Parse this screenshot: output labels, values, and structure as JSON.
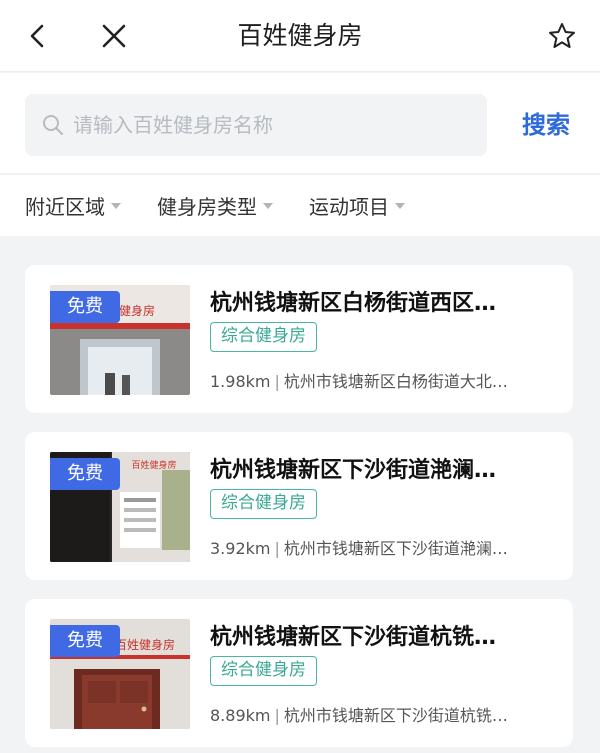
{
  "header": {
    "title": "百姓健身房",
    "back_icon": "chevron-left-icon",
    "close_icon": "close-icon",
    "favorite_icon": "star-outline-icon"
  },
  "search": {
    "placeholder": "请输入百姓健身房名称",
    "value": "",
    "button_label": "搜索",
    "icon": "search-icon"
  },
  "filters": [
    {
      "label": "附近区域"
    },
    {
      "label": "健身房类型"
    },
    {
      "label": "运动项目"
    }
  ],
  "cards": [
    {
      "badge": "免费",
      "title": "杭州钱塘新区白杨街道西区…",
      "tag": "综合健身房",
      "distance": "1.98km",
      "separator": "|",
      "address": "杭州市钱塘新区白杨街道大北…",
      "thumb_sign": "百姓健身房"
    },
    {
      "badge": "免费",
      "title": "杭州钱塘新区下沙街道滟澜…",
      "tag": "综合健身房",
      "distance": "3.92km",
      "separator": "|",
      "address": "杭州市钱塘新区下沙街道滟澜…",
      "thumb_sign": "百姓健身房"
    },
    {
      "badge": "免费",
      "title": "杭州钱塘新区下沙街道杭铣…",
      "tag": "综合健身房",
      "distance": "8.89km",
      "separator": "|",
      "address": "杭州市钱塘新区下沙街道杭铣…",
      "thumb_sign": "百姓健身房"
    }
  ],
  "colors": {
    "accent": "#2f6ad9",
    "badge": "#3f6ae3",
    "tag": "#3aa995",
    "background": "#f2f3f5"
  }
}
